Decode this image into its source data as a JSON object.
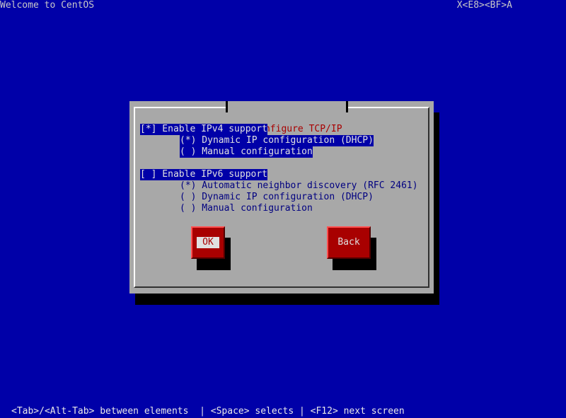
{
  "screen": {
    "title": "Welcome to CentOS",
    "top_right": "X<E8><BF>A",
    "help_line": "<Tab>/<Alt-Tab> between elements  | <Space> selects | <F12> next screen"
  },
  "dialog": {
    "title": "Configure TCP/IP",
    "ipv4": {
      "enable_label": "[*] Enable IPv4 support",
      "dhcp_label": "(*) Dynamic IP configuration (DHCP)",
      "manual_label": "( ) Manual configuration"
    },
    "ipv6": {
      "enable_label": "[ ] Enable IPv6 support",
      "auto_label": "(*) Automatic neighbor discovery (RFC 2461)",
      "dhcp_label": "( ) Dynamic IP configuration (DHCP)",
      "manual_label": "( ) Manual configuration"
    },
    "buttons": {
      "ok_label": "OK",
      "back_label": "Back"
    }
  },
  "colors": {
    "background": "#0000a8",
    "dialog": "#a8a8a8",
    "button": "#a80000",
    "title_text": "#a80000"
  }
}
